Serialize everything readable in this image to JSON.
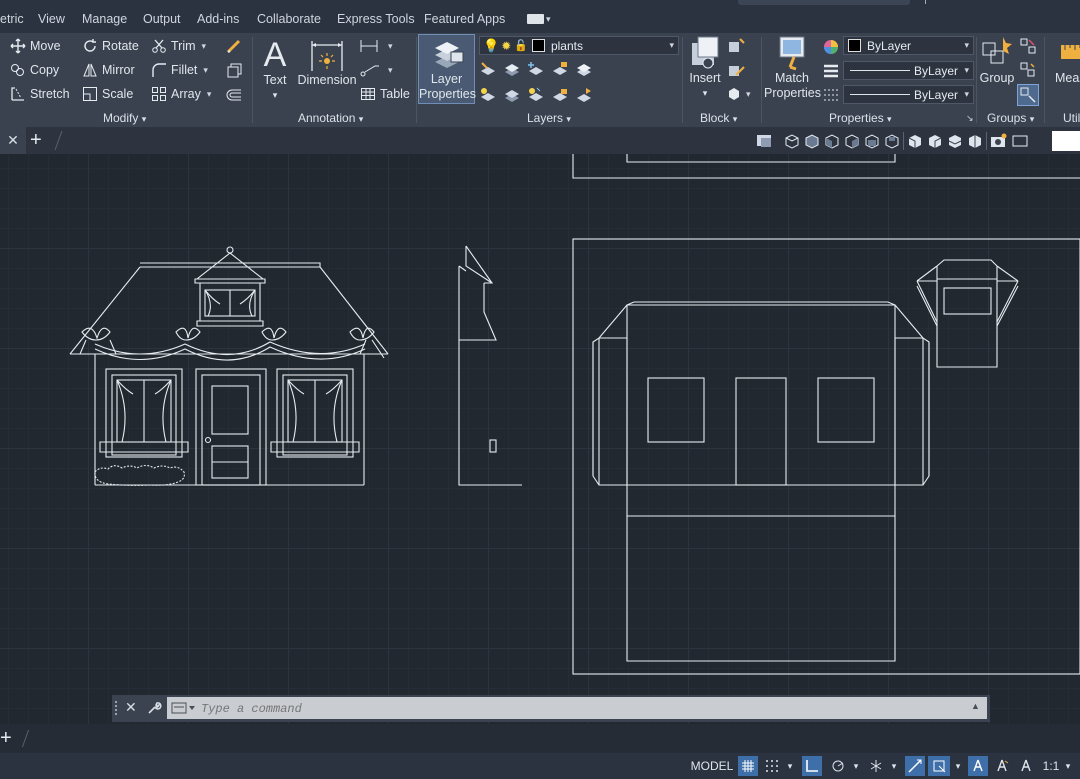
{
  "menu": {
    "tabs": [
      "etric",
      "View",
      "Manage",
      "Output",
      "Add-ins",
      "Collaborate",
      "Express Tools",
      "Featured Apps"
    ]
  },
  "ribbon": {
    "modify": {
      "title": "Modify",
      "buttons": [
        "Move",
        "Rotate",
        "Trim",
        "Copy",
        "Mirror",
        "Fillet",
        "Stretch",
        "Scale",
        "Array"
      ]
    },
    "annotation": {
      "title": "Annotation",
      "text": "Text",
      "dimension": "Dimension",
      "table": "Table"
    },
    "layers": {
      "title": "Layers",
      "layer_props_line1": "Layer",
      "layer_props_line2": "Properties",
      "current_layer": "plants"
    },
    "block": {
      "title": "Block",
      "insert": "Insert"
    },
    "properties": {
      "title": "Properties",
      "match_line1": "Match",
      "match_line2": "Properties",
      "color": "ByLayer",
      "linetype": "ByLayer",
      "lineweight": "ByLayer"
    },
    "groups": {
      "title": "Groups",
      "group": "Group"
    },
    "utilities": {
      "title": "Util",
      "measure": "Meas"
    }
  },
  "command": {
    "placeholder": "Type a command"
  },
  "status": {
    "model": "MODEL",
    "scale": "1:1"
  },
  "colors": {
    "accent": "#3f6fa8",
    "ribbon_bg": "#3a4250",
    "canvas_bg": "#212830",
    "drawing_line": "#e8ecf0"
  }
}
